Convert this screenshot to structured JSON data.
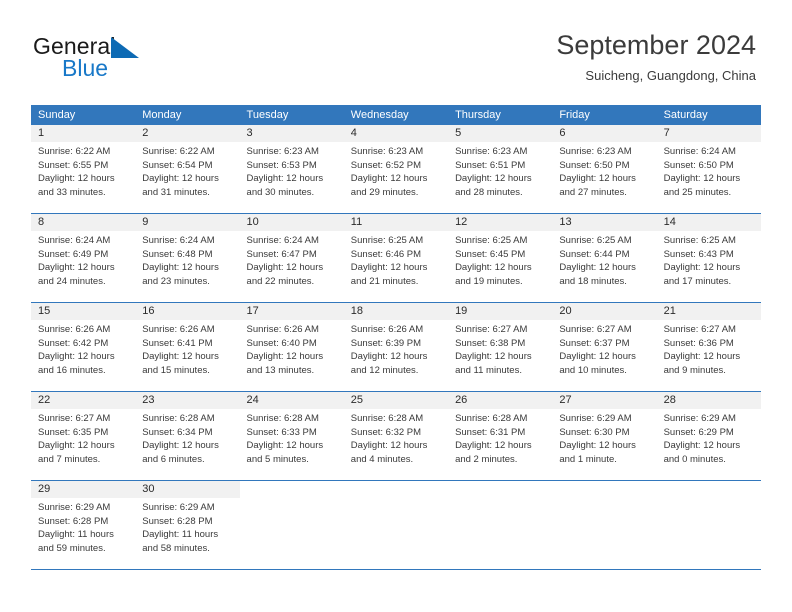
{
  "brand": {
    "name_top": "General",
    "name_bottom": "Blue",
    "accent_color": "#0d6ab4",
    "blue_text_color": "#1878c8"
  },
  "header": {
    "title": "September 2024",
    "subtitle": "Suicheng, Guangdong, China"
  },
  "theme": {
    "header_row_color": "#3277bc",
    "day_number_bg": "#f1f1f1",
    "grid_line_color": "#3277bc",
    "text_color": "#3a3a3a"
  },
  "weekdays": [
    {
      "label": "Sunday"
    },
    {
      "label": "Monday"
    },
    {
      "label": "Tuesday"
    },
    {
      "label": "Wednesday"
    },
    {
      "label": "Thursday"
    },
    {
      "label": "Friday"
    },
    {
      "label": "Saturday"
    }
  ],
  "weeks": [
    {
      "days": [
        {
          "num": "1",
          "sunrise": "Sunrise: 6:22 AM",
          "sunset": "Sunset: 6:55 PM",
          "daylight_line1": "Daylight: 12 hours",
          "daylight_line2": "and 33 minutes."
        },
        {
          "num": "2",
          "sunrise": "Sunrise: 6:22 AM",
          "sunset": "Sunset: 6:54 PM",
          "daylight_line1": "Daylight: 12 hours",
          "daylight_line2": "and 31 minutes."
        },
        {
          "num": "3",
          "sunrise": "Sunrise: 6:23 AM",
          "sunset": "Sunset: 6:53 PM",
          "daylight_line1": "Daylight: 12 hours",
          "daylight_line2": "and 30 minutes."
        },
        {
          "num": "4",
          "sunrise": "Sunrise: 6:23 AM",
          "sunset": "Sunset: 6:52 PM",
          "daylight_line1": "Daylight: 12 hours",
          "daylight_line2": "and 29 minutes."
        },
        {
          "num": "5",
          "sunrise": "Sunrise: 6:23 AM",
          "sunset": "Sunset: 6:51 PM",
          "daylight_line1": "Daylight: 12 hours",
          "daylight_line2": "and 28 minutes."
        },
        {
          "num": "6",
          "sunrise": "Sunrise: 6:23 AM",
          "sunset": "Sunset: 6:50 PM",
          "daylight_line1": "Daylight: 12 hours",
          "daylight_line2": "and 27 minutes."
        },
        {
          "num": "7",
          "sunrise": "Sunrise: 6:24 AM",
          "sunset": "Sunset: 6:50 PM",
          "daylight_line1": "Daylight: 12 hours",
          "daylight_line2": "and 25 minutes."
        }
      ]
    },
    {
      "days": [
        {
          "num": "8",
          "sunrise": "Sunrise: 6:24 AM",
          "sunset": "Sunset: 6:49 PM",
          "daylight_line1": "Daylight: 12 hours",
          "daylight_line2": "and 24 minutes."
        },
        {
          "num": "9",
          "sunrise": "Sunrise: 6:24 AM",
          "sunset": "Sunset: 6:48 PM",
          "daylight_line1": "Daylight: 12 hours",
          "daylight_line2": "and 23 minutes."
        },
        {
          "num": "10",
          "sunrise": "Sunrise: 6:24 AM",
          "sunset": "Sunset: 6:47 PM",
          "daylight_line1": "Daylight: 12 hours",
          "daylight_line2": "and 22 minutes."
        },
        {
          "num": "11",
          "sunrise": "Sunrise: 6:25 AM",
          "sunset": "Sunset: 6:46 PM",
          "daylight_line1": "Daylight: 12 hours",
          "daylight_line2": "and 21 minutes."
        },
        {
          "num": "12",
          "sunrise": "Sunrise: 6:25 AM",
          "sunset": "Sunset: 6:45 PM",
          "daylight_line1": "Daylight: 12 hours",
          "daylight_line2": "and 19 minutes."
        },
        {
          "num": "13",
          "sunrise": "Sunrise: 6:25 AM",
          "sunset": "Sunset: 6:44 PM",
          "daylight_line1": "Daylight: 12 hours",
          "daylight_line2": "and 18 minutes."
        },
        {
          "num": "14",
          "sunrise": "Sunrise: 6:25 AM",
          "sunset": "Sunset: 6:43 PM",
          "daylight_line1": "Daylight: 12 hours",
          "daylight_line2": "and 17 minutes."
        }
      ]
    },
    {
      "days": [
        {
          "num": "15",
          "sunrise": "Sunrise: 6:26 AM",
          "sunset": "Sunset: 6:42 PM",
          "daylight_line1": "Daylight: 12 hours",
          "daylight_line2": "and 16 minutes."
        },
        {
          "num": "16",
          "sunrise": "Sunrise: 6:26 AM",
          "sunset": "Sunset: 6:41 PM",
          "daylight_line1": "Daylight: 12 hours",
          "daylight_line2": "and 15 minutes."
        },
        {
          "num": "17",
          "sunrise": "Sunrise: 6:26 AM",
          "sunset": "Sunset: 6:40 PM",
          "daylight_line1": "Daylight: 12 hours",
          "daylight_line2": "and 13 minutes."
        },
        {
          "num": "18",
          "sunrise": "Sunrise: 6:26 AM",
          "sunset": "Sunset: 6:39 PM",
          "daylight_line1": "Daylight: 12 hours",
          "daylight_line2": "and 12 minutes."
        },
        {
          "num": "19",
          "sunrise": "Sunrise: 6:27 AM",
          "sunset": "Sunset: 6:38 PM",
          "daylight_line1": "Daylight: 12 hours",
          "daylight_line2": "and 11 minutes."
        },
        {
          "num": "20",
          "sunrise": "Sunrise: 6:27 AM",
          "sunset": "Sunset: 6:37 PM",
          "daylight_line1": "Daylight: 12 hours",
          "daylight_line2": "and 10 minutes."
        },
        {
          "num": "21",
          "sunrise": "Sunrise: 6:27 AM",
          "sunset": "Sunset: 6:36 PM",
          "daylight_line1": "Daylight: 12 hours",
          "daylight_line2": "and 9 minutes."
        }
      ]
    },
    {
      "days": [
        {
          "num": "22",
          "sunrise": "Sunrise: 6:27 AM",
          "sunset": "Sunset: 6:35 PM",
          "daylight_line1": "Daylight: 12 hours",
          "daylight_line2": "and 7 minutes."
        },
        {
          "num": "23",
          "sunrise": "Sunrise: 6:28 AM",
          "sunset": "Sunset: 6:34 PM",
          "daylight_line1": "Daylight: 12 hours",
          "daylight_line2": "and 6 minutes."
        },
        {
          "num": "24",
          "sunrise": "Sunrise: 6:28 AM",
          "sunset": "Sunset: 6:33 PM",
          "daylight_line1": "Daylight: 12 hours",
          "daylight_line2": "and 5 minutes."
        },
        {
          "num": "25",
          "sunrise": "Sunrise: 6:28 AM",
          "sunset": "Sunset: 6:32 PM",
          "daylight_line1": "Daylight: 12 hours",
          "daylight_line2": "and 4 minutes."
        },
        {
          "num": "26",
          "sunrise": "Sunrise: 6:28 AM",
          "sunset": "Sunset: 6:31 PM",
          "daylight_line1": "Daylight: 12 hours",
          "daylight_line2": "and 2 minutes."
        },
        {
          "num": "27",
          "sunrise": "Sunrise: 6:29 AM",
          "sunset": "Sunset: 6:30 PM",
          "daylight_line1": "Daylight: 12 hours",
          "daylight_line2": "and 1 minute."
        },
        {
          "num": "28",
          "sunrise": "Sunrise: 6:29 AM",
          "sunset": "Sunset: 6:29 PM",
          "daylight_line1": "Daylight: 12 hours",
          "daylight_line2": "and 0 minutes."
        }
      ]
    },
    {
      "days": [
        {
          "num": "29",
          "sunrise": "Sunrise: 6:29 AM",
          "sunset": "Sunset: 6:28 PM",
          "daylight_line1": "Daylight: 11 hours",
          "daylight_line2": "and 59 minutes."
        },
        {
          "num": "30",
          "sunrise": "Sunrise: 6:29 AM",
          "sunset": "Sunset: 6:28 PM",
          "daylight_line1": "Daylight: 11 hours",
          "daylight_line2": "and 58 minutes."
        }
      ]
    }
  ]
}
